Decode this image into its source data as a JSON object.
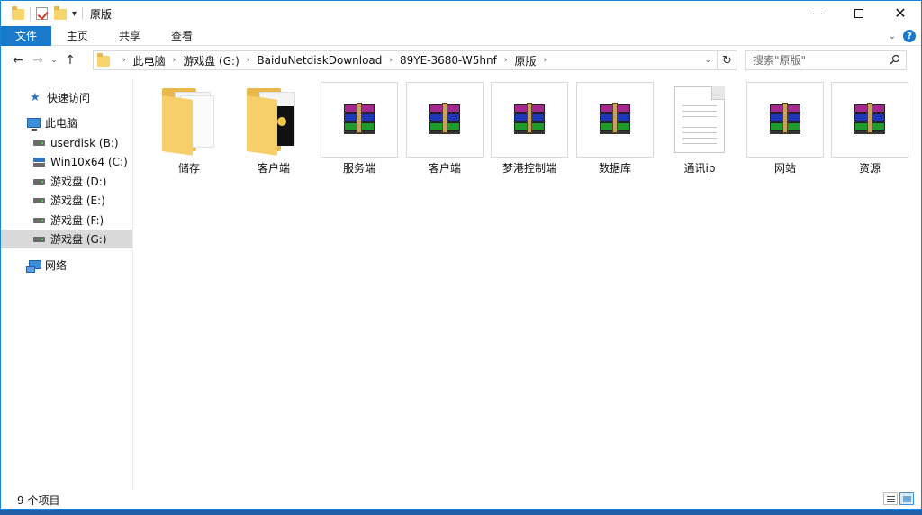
{
  "window": {
    "title": "原版",
    "qa_dropdown": "▾"
  },
  "ribbon": {
    "tabs": [
      {
        "label": "文件"
      },
      {
        "label": "主页"
      },
      {
        "label": "共享"
      },
      {
        "label": "查看"
      }
    ]
  },
  "address": {
    "crumbs": [
      "此电脑",
      "游戏盘 (G:)",
      "BaiduNetdiskDownload",
      "89YE-3680-W5hnf",
      "原版"
    ]
  },
  "search": {
    "placeholder": "搜索\"原版\""
  },
  "sidebar": {
    "items": [
      {
        "label": "快速访问",
        "icon": "star-icon"
      },
      {
        "label": "此电脑",
        "icon": "pc-icon"
      },
      {
        "label": "userdisk (B:)",
        "icon": "drive-icon"
      },
      {
        "label": "Win10x64 (C:)",
        "icon": "windows-drive-icon"
      },
      {
        "label": "游戏盘 (D:)",
        "icon": "drive-icon"
      },
      {
        "label": "游戏盘 (E:)",
        "icon": "drive-icon"
      },
      {
        "label": "游戏盘 (F:)",
        "icon": "drive-icon"
      },
      {
        "label": "游戏盘 (G:)",
        "icon": "drive-icon",
        "selected": true
      },
      {
        "label": "网络",
        "icon": "network-icon"
      }
    ]
  },
  "files": [
    {
      "name": "储存",
      "type": "folder"
    },
    {
      "name": "客户端",
      "type": "folder"
    },
    {
      "name": "服务端",
      "type": "rar"
    },
    {
      "name": "客户端",
      "type": "rar"
    },
    {
      "name": "梦港控制端",
      "type": "rar"
    },
    {
      "name": "数据库",
      "type": "rar"
    },
    {
      "name": "通讯ip",
      "type": "text"
    },
    {
      "name": "网站",
      "type": "rar"
    },
    {
      "name": "资源",
      "type": "rar"
    }
  ],
  "status": {
    "item_count": "9 个项目"
  },
  "colors": {
    "accent": "#1979ca",
    "selection": "#d9d9d9"
  }
}
